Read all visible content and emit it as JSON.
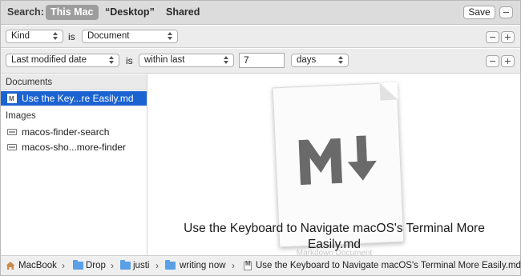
{
  "search": {
    "label": "Search:",
    "scopes": [
      {
        "label": "This Mac",
        "active": true
      },
      {
        "label": "“Desktop”",
        "active": false
      },
      {
        "label": "Shared",
        "active": false
      }
    ],
    "save_label": "Save"
  },
  "criteria": {
    "row1": {
      "attribute": "Kind",
      "connector": "is",
      "value": "Document"
    },
    "row2": {
      "attribute": "Last modified date",
      "connector": "is",
      "operator": "within last",
      "amount": "7",
      "unit": "days"
    }
  },
  "sidebar": {
    "sections": [
      {
        "title": "Documents",
        "items": [
          "Use the Key...re Easily.md"
        ]
      },
      {
        "title": "Images",
        "items": [
          "macos-finder-search",
          "macos-sho...more-finder"
        ]
      }
    ]
  },
  "preview": {
    "title_line1": "Use the Keyboard to Navigate macOS's Terminal More",
    "title_line2": "Easily.md",
    "subtitle": "Markdown Document"
  },
  "pathbar": {
    "crumbs": [
      "MacBook",
      "Drop",
      "justi",
      "writing now",
      "Use the Keyboard to Navigate macOS's Terminal More Easily.md"
    ]
  },
  "icons": {
    "home": "home-icon",
    "folder": "folder-icon",
    "markdown_file": "markdown-file-icon",
    "image_file": "image-file-icon"
  }
}
